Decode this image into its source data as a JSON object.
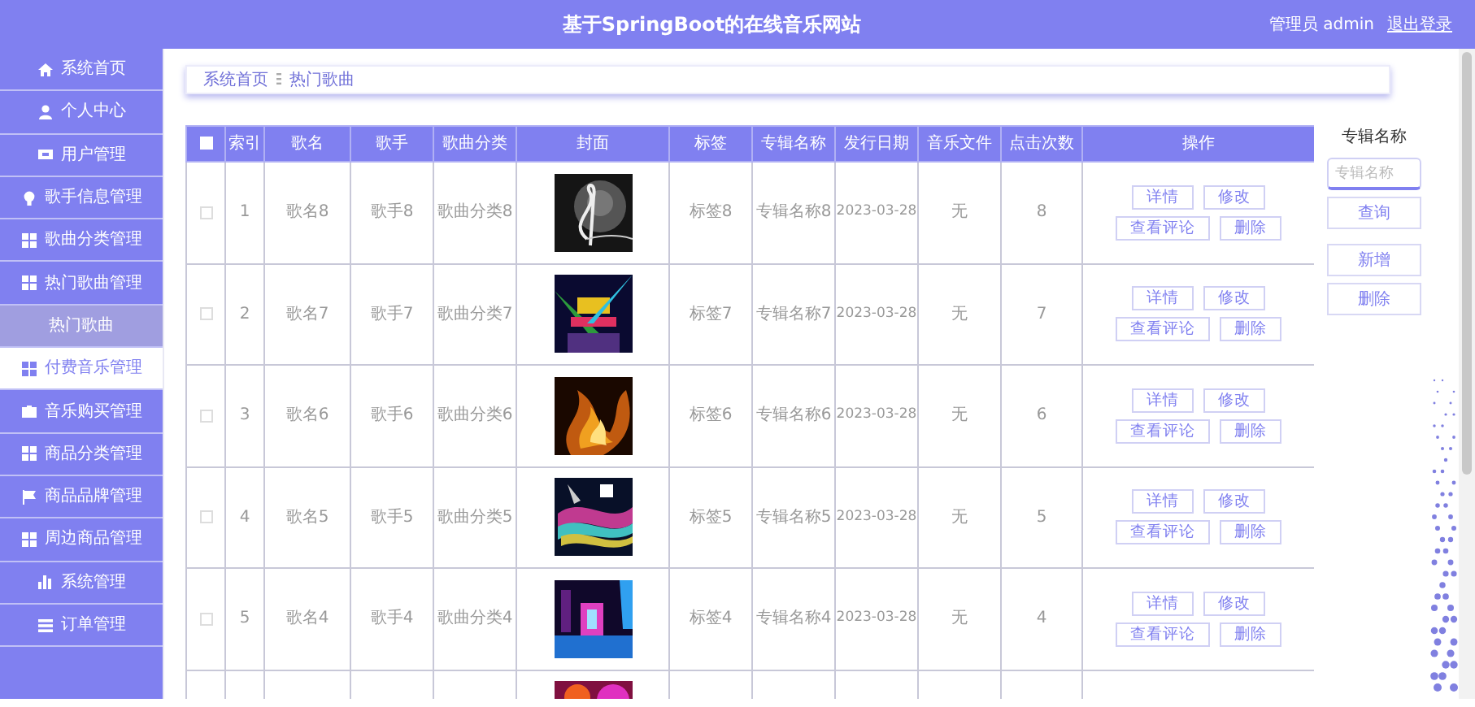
{
  "header": {
    "title": "基于SpringBoot的在线音乐网站",
    "user": "管理员 admin",
    "logout": "退出登录"
  },
  "sidebar": {
    "items": [
      {
        "label": "系统首页",
        "hovered": false
      },
      {
        "label": "个人中心",
        "hovered": false
      },
      {
        "label": "用户管理",
        "hovered": false
      },
      {
        "label": "歌手信息管理",
        "hovered": false
      },
      {
        "label": "歌曲分类管理",
        "hovered": false
      },
      {
        "label": "热门歌曲管理",
        "hovered": false,
        "children": [
          {
            "label": "热门歌曲",
            "selected": true
          }
        ]
      },
      {
        "label": "付费音乐管理",
        "hovered": true
      },
      {
        "label": "音乐购买管理",
        "hovered": false
      },
      {
        "label": "商品分类管理",
        "hovered": false
      },
      {
        "label": "商品品牌管理",
        "hovered": false
      },
      {
        "label": "周边商品管理",
        "hovered": false
      },
      {
        "label": "系统管理",
        "hovered": false
      },
      {
        "label": "订单管理",
        "hovered": false
      }
    ]
  },
  "breadcrumb": [
    "系统首页",
    "热门歌曲"
  ],
  "table": {
    "select_all": {
      "checked": false
    },
    "columns": [
      "索引",
      "歌名",
      "歌手",
      "歌曲分类",
      "封面",
      "标签",
      "专辑名称",
      "发行日期",
      "音乐文件",
      "点击次数",
      "操作"
    ],
    "rows": [
      {
        "checked": false,
        "index": "1",
        "name": "歌名8",
        "singer": "歌手8",
        "category": "歌曲分类8",
        "cover": {
          "kind": "picture"
        },
        "tag": "标签8",
        "album": "专辑名称8",
        "date": "2023-03-28",
        "file": "无",
        "clicks": "8",
        "actions": [
          "详情",
          "修改",
          "查看评论",
          "删除"
        ]
      },
      {
        "checked": false,
        "index": "2",
        "name": "歌名7",
        "singer": "歌手7",
        "category": "歌曲分类7",
        "cover": {
          "kind": "picture"
        },
        "tag": "标签7",
        "album": "专辑名称7",
        "date": "2023-03-28",
        "file": "无",
        "clicks": "7",
        "actions": [
          "详情",
          "修改",
          "查看评论",
          "删除"
        ]
      },
      {
        "checked": false,
        "index": "3",
        "name": "歌名6",
        "singer": "歌手6",
        "category": "歌曲分类6",
        "cover": {
          "kind": "picture"
        },
        "tag": "标签6",
        "album": "专辑名称6",
        "date": "2023-03-28",
        "file": "无",
        "clicks": "6",
        "actions": [
          "详情",
          "修改",
          "查看评论",
          "删除"
        ]
      },
      {
        "checked": false,
        "index": "4",
        "name": "歌名5",
        "singer": "歌手5",
        "category": "歌曲分类5",
        "cover": {
          "kind": "picture"
        },
        "tag": "标签5",
        "album": "专辑名称5",
        "date": "2023-03-28",
        "file": "无",
        "clicks": "5",
        "actions": [
          "详情",
          "修改",
          "查看评论",
          "删除"
        ]
      },
      {
        "checked": false,
        "index": "5",
        "name": "歌名4",
        "singer": "歌手4",
        "category": "歌曲分类4",
        "cover": {
          "kind": "picture"
        },
        "tag": "标签4",
        "album": "专辑名称4",
        "date": "2023-03-28",
        "file": "无",
        "clicks": "4",
        "actions": [
          "详情",
          "修改",
          "查看评论",
          "删除"
        ]
      },
      {
        "cover": {
          "kind": "picture"
        }
      }
    ]
  },
  "search": {
    "label": "专辑名称",
    "placeholder": "专辑名称",
    "buttons": [
      "查询",
      "新增",
      "删除"
    ]
  }
}
